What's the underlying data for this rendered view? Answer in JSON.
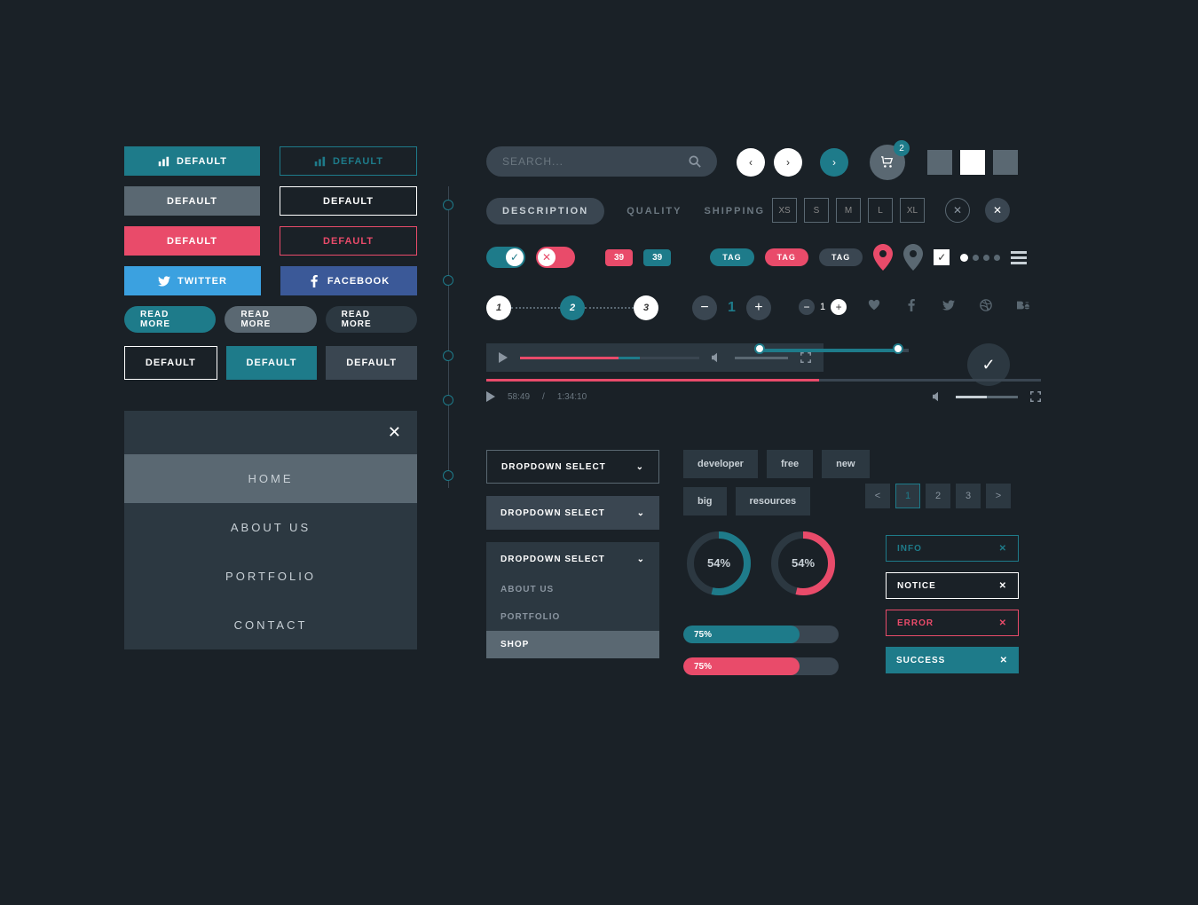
{
  "colors": {
    "teal": "#1e7b8a",
    "pink": "#e94b6a",
    "gray": "#5a6872",
    "dark": "#2c3841"
  },
  "buttons": {
    "default": "DEFAULT",
    "twitter": "TWITTER",
    "facebook": "FACEBOOK",
    "readmore": "READ MORE"
  },
  "nav": {
    "items": [
      "HOME",
      "ABOUT US",
      "PORTFOLIO",
      "CONTACT"
    ],
    "activeIndex": 0
  },
  "search": {
    "placeholder": "SEARCH..."
  },
  "cart": {
    "badge": "2"
  },
  "tabs": [
    "DESCRIPTION",
    "QUALITY",
    "SHIPPING"
  ],
  "sizes": [
    "XS",
    "S",
    "M",
    "L",
    "XL"
  ],
  "badges": [
    "39",
    "39"
  ],
  "tags": [
    "TAG",
    "TAG",
    "TAG"
  ],
  "steps": [
    "1",
    "2",
    "3"
  ],
  "stepper": {
    "value": "1"
  },
  "ministepper": {
    "value": "1"
  },
  "player": {
    "current": "58:49",
    "total": "1:34:10"
  },
  "dropdown": {
    "label": "DROPDOWN SELECT",
    "items": [
      "ABOUT US",
      "PORTFOLIO",
      "SHOP"
    ],
    "selected": "SHOP"
  },
  "tagcloud": [
    "developer",
    "free",
    "new",
    "big",
    "resources"
  ],
  "pagination": [
    "<",
    "1",
    "2",
    "3",
    ">"
  ],
  "donuts": [
    {
      "pct": "54%",
      "val": 54
    },
    {
      "pct": "54%",
      "val": 54
    }
  ],
  "progress": [
    {
      "pct": "75%",
      "val": 75
    },
    {
      "pct": "75%",
      "val": 75
    }
  ],
  "alerts": [
    {
      "label": "INFO",
      "cls": "aInfo"
    },
    {
      "label": "NOTICE",
      "cls": "aNotice"
    },
    {
      "label": "ERROR",
      "cls": "aError"
    },
    {
      "label": "SUCCESS",
      "cls": "aSuccess"
    }
  ]
}
